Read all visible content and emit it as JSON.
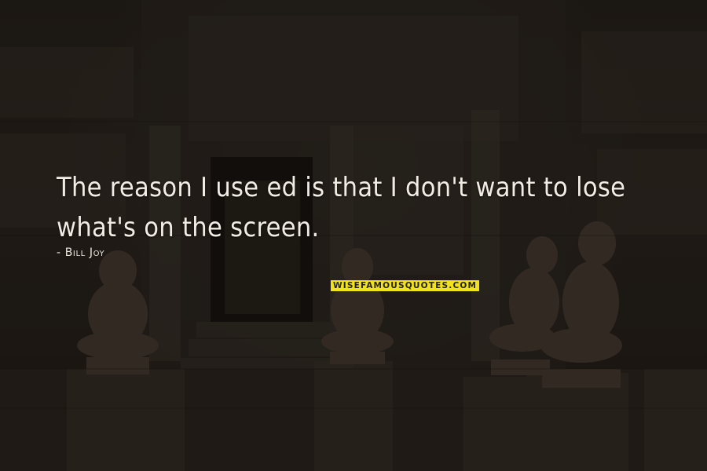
{
  "quote": {
    "text": "The reason I use ed is that I don't want to lose what's on the screen.",
    "author": "- Bill Joy"
  },
  "watermark": {
    "label": "WISEFAMOUSQUOTES.COM",
    "color": "#f2e21b"
  },
  "background": {
    "description_color": "#26211c"
  }
}
